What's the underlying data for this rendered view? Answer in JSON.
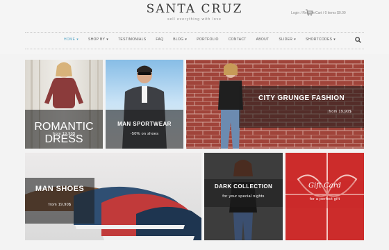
{
  "brand": {
    "name": "SANTA CRUZ",
    "tagline": "sell everything with love"
  },
  "account": {
    "text": "Login / Register"
  },
  "cart": {
    "text": "Cart / 0 items $0.00"
  },
  "nav": [
    {
      "label": "HOME",
      "caret": "▾",
      "active": true
    },
    {
      "label": "SHOP BY",
      "caret": "▾"
    },
    {
      "label": "TESTIMONIALS",
      "caret": ""
    },
    {
      "label": "FAQ",
      "caret": ""
    },
    {
      "label": "BLOG",
      "caret": "▾"
    },
    {
      "label": "PORTFOLIO",
      "caret": ""
    },
    {
      "label": "CONTACT",
      "caret": ""
    },
    {
      "label": "ABOUT",
      "caret": ""
    },
    {
      "label": "SLIDER",
      "caret": "▾"
    },
    {
      "label": "SHORTCODES",
      "caret": "▾"
    }
  ],
  "tiles": {
    "romantic": {
      "title": "ROMANTIC DRESS",
      "sub": "from 19,90$"
    },
    "sportwear": {
      "title": "MAN SPORTWEAR",
      "sub": "-50% on shoes"
    },
    "grunge": {
      "title": "CITY GRUNGE FASHION",
      "sub": "from 19,90$"
    },
    "shoes": {
      "title": "MAN SHOES",
      "sub": "from 19,90$"
    },
    "dark": {
      "title": "DARK COLLECTION",
      "sub": "for your special nights"
    },
    "gift": {
      "title": "Gift Card",
      "sub": "for a perfect gift"
    }
  },
  "colors": {
    "accent": "#58a6c7",
    "gift_red": "#cc2c2b",
    "brick": "#a5443a"
  }
}
